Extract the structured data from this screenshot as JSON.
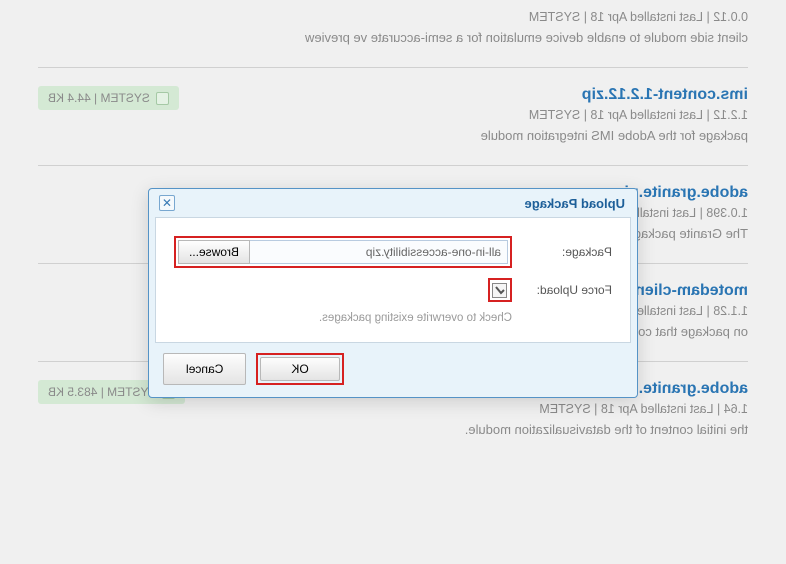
{
  "packages": [
    {
      "title_fragment": "",
      "meta": "0.0.12 | Last installed Apr 18 | SYSTEM",
      "desc": "client side module to enable device emulation for a semi-accurate ve preview",
      "badge": ""
    },
    {
      "title": "ims.content-1.2.12.zip",
      "meta": "1.2.12 | Last installed Apr 18 | SYSTEM",
      "desc": "package for the Adobe IMS integration module",
      "badge": "SYSTEM | 44.4 KB"
    },
    {
      "title": "adobe.granite.ui.cor",
      "meta": "1.0.398 | Last installed A",
      "desc": "The Granite package wrap",
      "badge": ""
    },
    {
      "title": "motedam-client-ui",
      "meta": "1.1.28 | Last installed Ap",
      "desc": "on package that contains repository content for Adobe CQ Remote",
      "badge": ""
    },
    {
      "title": "adobe.granite.datavisualization.content-1.64.zip",
      "meta": "1.64 | Last installed Apr 18 | SYSTEM",
      "desc": "the initial content of the datavisualization module.",
      "badge": "SYSTEM | 483.5 KB"
    }
  ],
  "dialog": {
    "title": "Upload Package",
    "labels": {
      "package": "Package:",
      "force": "Force Upload:"
    },
    "file_value": "all-in-one-accessibility.zip",
    "browse_label": "Browse...",
    "hint": "Check to overwrite existing packages.",
    "ok_label": "OK",
    "cancel_label": "Cancel"
  }
}
